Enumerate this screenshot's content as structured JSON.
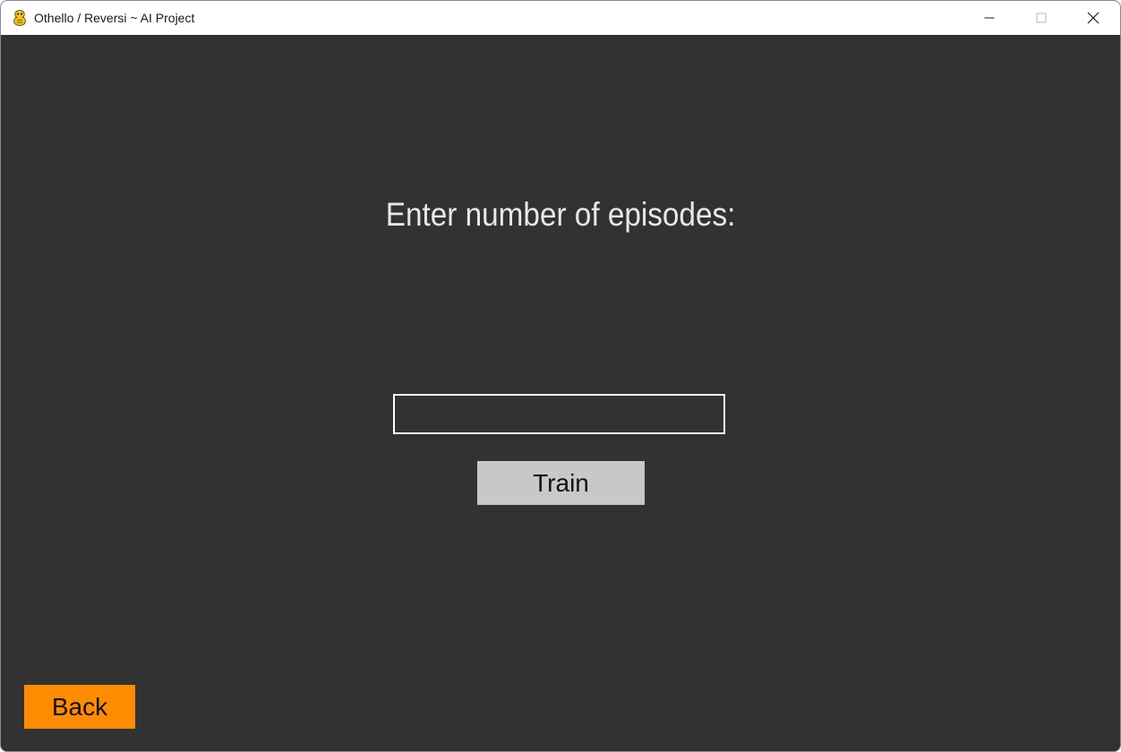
{
  "window": {
    "title": "Othello / Reversi ~ AI Project",
    "app_icon": "pygame-snake-icon",
    "controls": {
      "minimize_icon": "minimize-icon",
      "maximize_icon": "maximize-icon",
      "close_icon": "close-icon"
    }
  },
  "screen": {
    "prompt": "Enter number of episodes:",
    "episodes_input": {
      "value": "",
      "placeholder": ""
    },
    "train_label": "Train",
    "back_label": "Back"
  },
  "colors": {
    "background": "#323232",
    "text": "#e8e8e8",
    "input_border": "#ffffff",
    "train_button": "#c8c8c8",
    "back_button": "#ff8c00"
  }
}
